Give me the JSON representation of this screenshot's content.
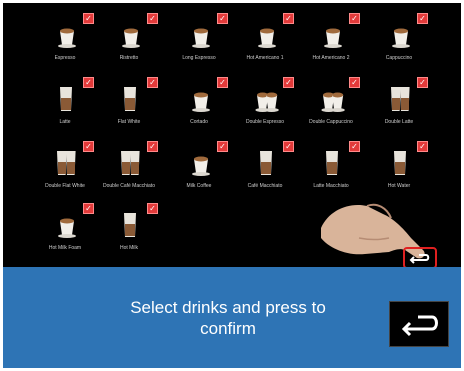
{
  "drinks": [
    {
      "name": "Espresso",
      "icon": "espresso-cup-icon",
      "checked": true
    },
    {
      "name": "Ristretto",
      "icon": "ristretto-cup-icon",
      "checked": true
    },
    {
      "name": "Long Espresso",
      "icon": "long-espresso-cup-icon",
      "checked": true
    },
    {
      "name": "Hot Americano 1",
      "icon": "americano-cup-icon",
      "checked": true
    },
    {
      "name": "Hot Americano 2",
      "icon": "americano-cup-icon",
      "checked": true
    },
    {
      "name": "Cappuccino",
      "icon": "cappuccino-cup-icon",
      "checked": true
    },
    {
      "name": "Latte",
      "icon": "latte-glass-icon",
      "checked": true
    },
    {
      "name": "Flat White",
      "icon": "flat-white-glass-icon",
      "checked": true
    },
    {
      "name": "Cortado",
      "icon": "cortado-cup-icon",
      "checked": true
    },
    {
      "name": "Double Espresso",
      "icon": "double-espresso-cup-icon",
      "checked": true
    },
    {
      "name": "Double Cappuccino",
      "icon": "double-cappuccino-cup-icon",
      "checked": true
    },
    {
      "name": "Double Latte",
      "icon": "double-latte-glass-icon",
      "checked": true
    },
    {
      "name": "Double Flat White",
      "icon": "double-flat-white-glass-icon",
      "checked": true
    },
    {
      "name": "Double Café Macchiato",
      "icon": "double-macchiato-glass-icon",
      "checked": true
    },
    {
      "name": "Milk Coffee",
      "icon": "milk-coffee-cup-icon",
      "checked": true
    },
    {
      "name": "Café Macchiato",
      "icon": "macchiato-glass-icon",
      "checked": true
    },
    {
      "name": "Latte Macchiato",
      "icon": "latte-macchiato-glass-icon",
      "checked": true
    },
    {
      "name": "Hot Water",
      "icon": "hot-water-glass-icon",
      "checked": true
    },
    {
      "name": "Hot Milk Foam",
      "icon": "milk-foam-cup-icon",
      "checked": true
    },
    {
      "name": "Hot Milk",
      "icon": "hot-milk-glass-icon",
      "checked": true
    }
  ],
  "banner": {
    "message": "Select drinks and press to confirm",
    "confirm_icon": "return-arrow-icon"
  },
  "colors": {
    "screen_bg": "#000000",
    "banner_bg": "#2e74b5",
    "check": "#e23a3a",
    "highlight": "#e02020"
  }
}
